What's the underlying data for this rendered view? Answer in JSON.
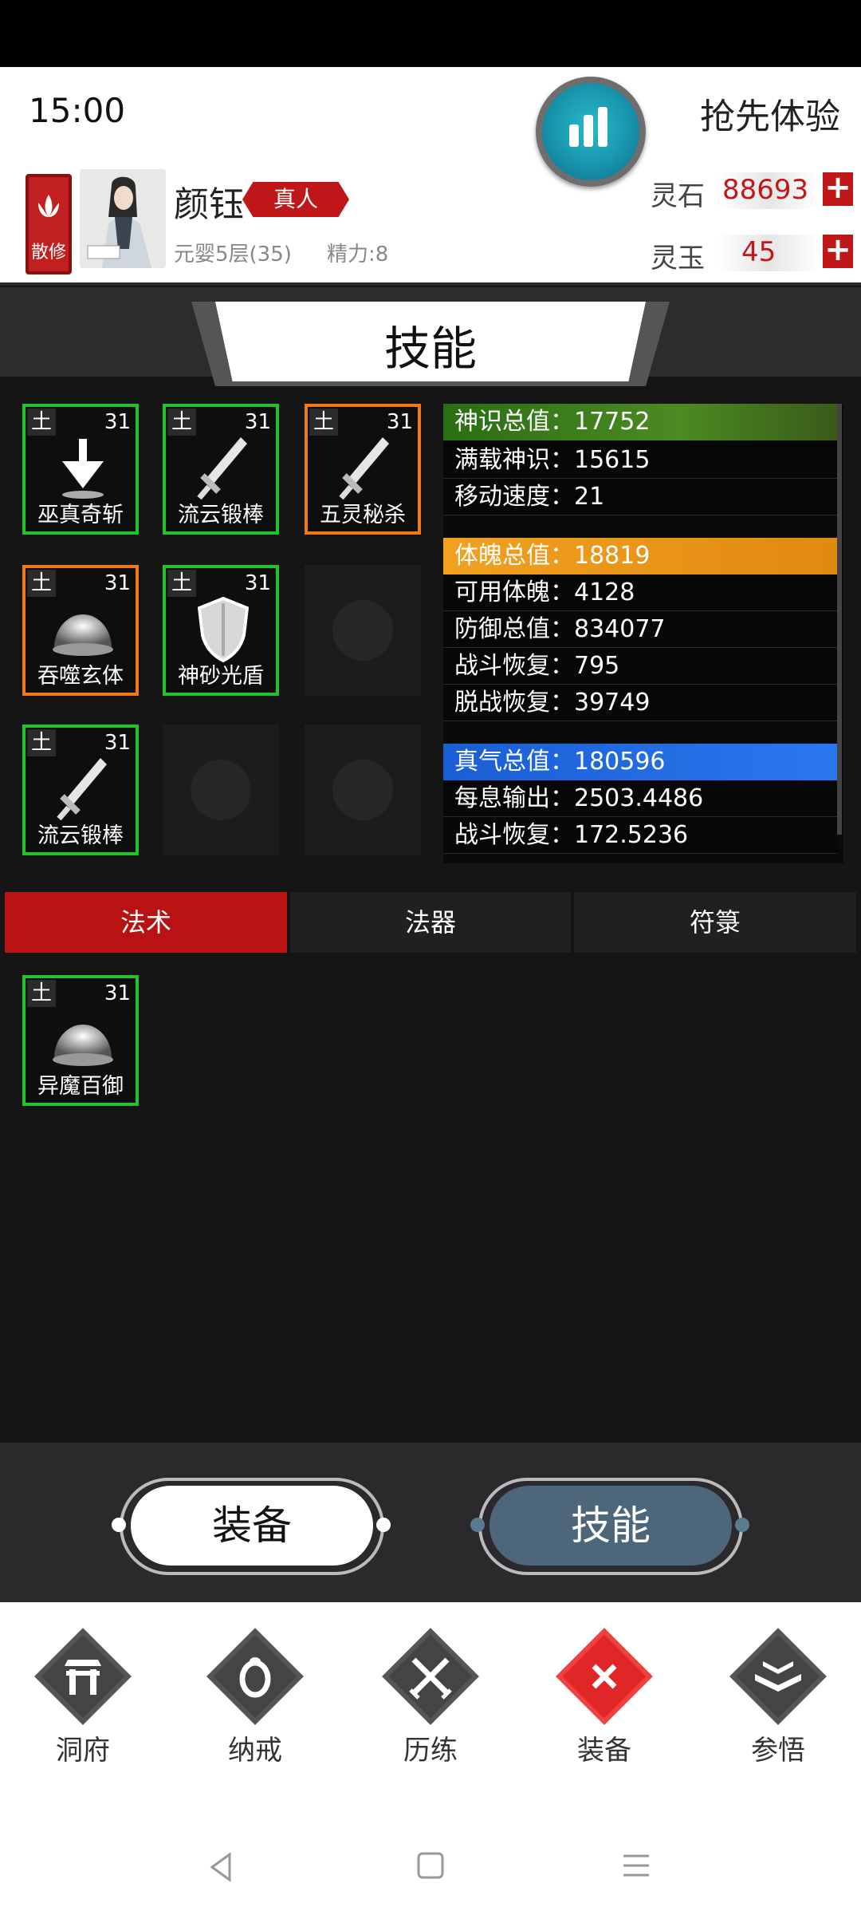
{
  "status": {
    "time": "15:00",
    "preview": "抢先体验"
  },
  "player": {
    "sect": "散修",
    "name": "颜钰",
    "title": "真人",
    "realm": "元婴5层(35)",
    "stamina": "精力:8"
  },
  "currency": [
    {
      "label": "灵石",
      "value": "88693"
    },
    {
      "label": "灵玉",
      "value": "45"
    }
  ],
  "page_title": "技能",
  "skills": [
    {
      "element": "土",
      "level": "31",
      "name": "巫真奇斩",
      "rarity": "green",
      "icon": "arrow-down-icon"
    },
    {
      "element": "土",
      "level": "31",
      "name": "流云锻棒",
      "rarity": "green",
      "icon": "sword-icon"
    },
    {
      "element": "土",
      "level": "31",
      "name": "五灵秘杀",
      "rarity": "orange",
      "icon": "sword-icon"
    },
    {
      "element": "土",
      "level": "31",
      "name": "吞噬玄体",
      "rarity": "orange",
      "icon": "dome-icon"
    },
    {
      "element": "土",
      "level": "31",
      "name": "神砂光盾",
      "rarity": "green",
      "icon": "shield-icon"
    },
    {
      "element": "土",
      "level": "31",
      "name": "流云锻棒",
      "rarity": "green",
      "icon": "sword-icon"
    }
  ],
  "stats": {
    "shenshi": {
      "header": "神识总值：17752",
      "rows": [
        "满载神识：15615",
        "移动速度：21"
      ]
    },
    "tipo": {
      "header": "体魄总值：18819",
      "rows": [
        "可用体魄：4128",
        "防御总值：834077",
        "战斗恢复：795",
        "脱战恢复：39749"
      ]
    },
    "zhenqi": {
      "header": "真气总值：180596",
      "rows": [
        "每息输出：2503.4486",
        "战斗恢复：172.5236"
      ]
    }
  },
  "tabs": [
    "法术",
    "法器",
    "符箓"
  ],
  "inventory": [
    {
      "element": "土",
      "level": "31",
      "name": "异魔百御",
      "rarity": "green",
      "icon": "dome-icon"
    }
  ],
  "actions": {
    "equip": "装备",
    "skill": "技能"
  },
  "nav": [
    {
      "label": "洞府",
      "icon": "gate-icon",
      "active": false
    },
    {
      "label": "纳戒",
      "icon": "ring-icon",
      "active": false
    },
    {
      "label": "历练",
      "icon": "crossed-swords-icon",
      "active": false
    },
    {
      "label": "装备",
      "icon": "close-x-icon",
      "active": true
    },
    {
      "label": "参悟",
      "icon": "book-icon",
      "active": false
    }
  ],
  "colors": {
    "accent_red": "#c01818",
    "rarity_green": "#25c12d",
    "rarity_orange": "#f07a1a"
  }
}
